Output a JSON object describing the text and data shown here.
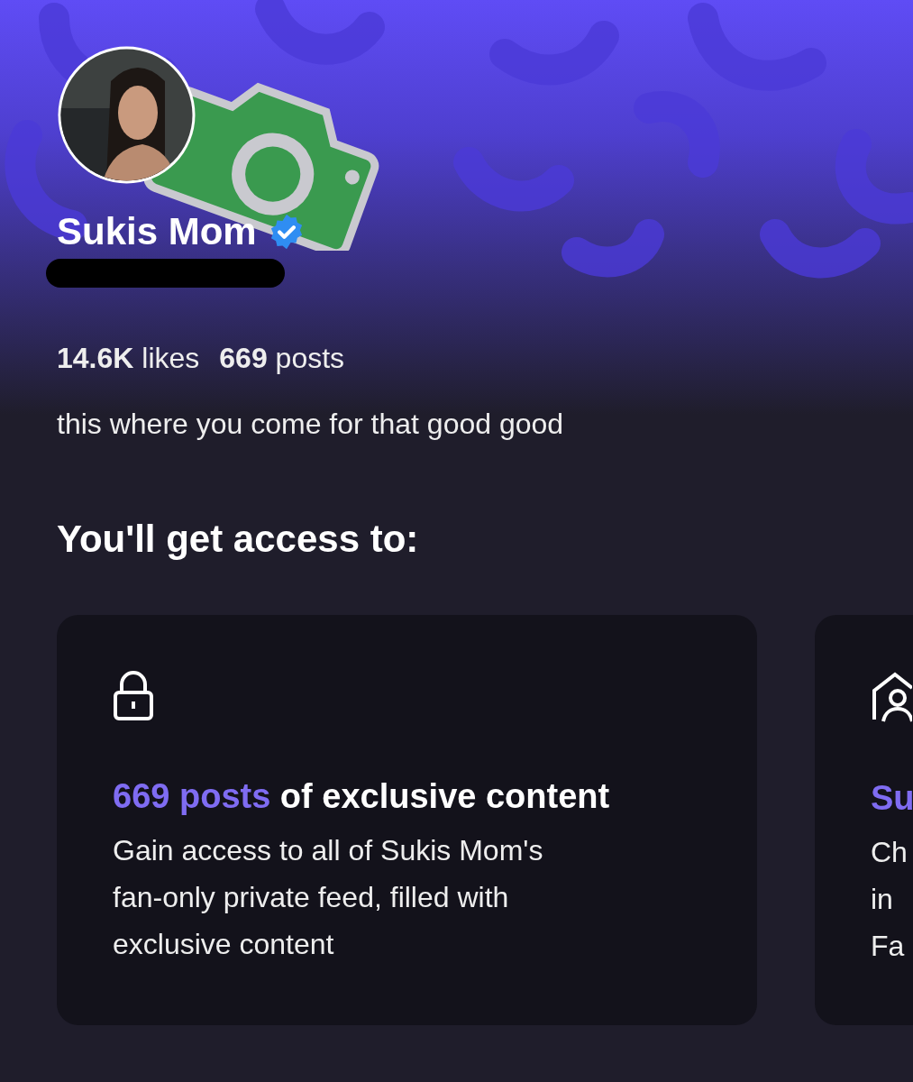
{
  "profile": {
    "name": "Sukis Mom",
    "verified": true,
    "handle_redacted": true,
    "stats": [
      "**14.6K** likes",
      "**669** posts"
    ],
    "bio": "this where you come for that good good"
  },
  "access": {
    "title": "You'll get access to:",
    "cards": [
      {
        "kind": "lock",
        "highlight": "669 posts",
        "title": " of exclusive content",
        "lines": [
          "Gain access to all of Sukis Mom's",
          "fan-only private feed, filled with",
          "exclusive content"
        ]
      },
      {
        "kind": "home-person",
        "highlight": "Su",
        "lines": [
          "Ch",
          "in",
          "Fa"
        ]
      }
    ]
  }
}
